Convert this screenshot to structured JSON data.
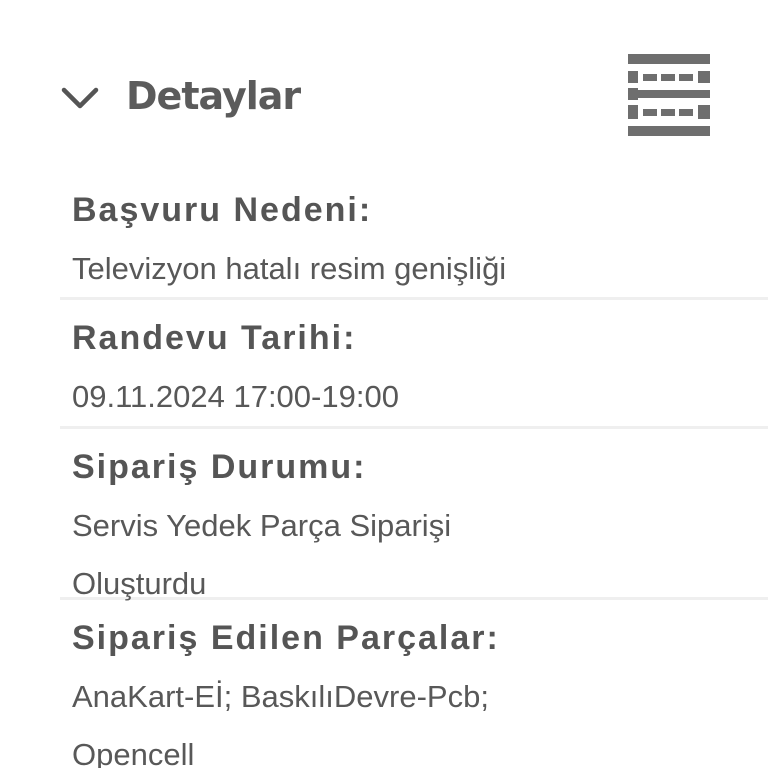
{
  "header": {
    "title": "Detaylar",
    "collapse_icon": "chevron-down-icon",
    "table_view_icon": "table-icon"
  },
  "details": [
    {
      "label": "Başvuru Nedeni:",
      "value": "Televizyon hatalı resim genişliği"
    },
    {
      "label": "Randevu Tarihi:",
      "value": "09.11.2024 17:00-19:00"
    },
    {
      "label": "Sipariş Durumu:",
      "value": "Servis Yedek Parça Siparişi\nOluşturdu"
    },
    {
      "label": "Sipariş Edilen Parçalar:",
      "value": "AnaKart-Eİ; BaskılıDevre-Pcb;\nOpencell"
    }
  ],
  "colors": {
    "text": "#555555",
    "divider": "#efefef",
    "icon": "#6e6e6e",
    "background": "#ffffff"
  }
}
